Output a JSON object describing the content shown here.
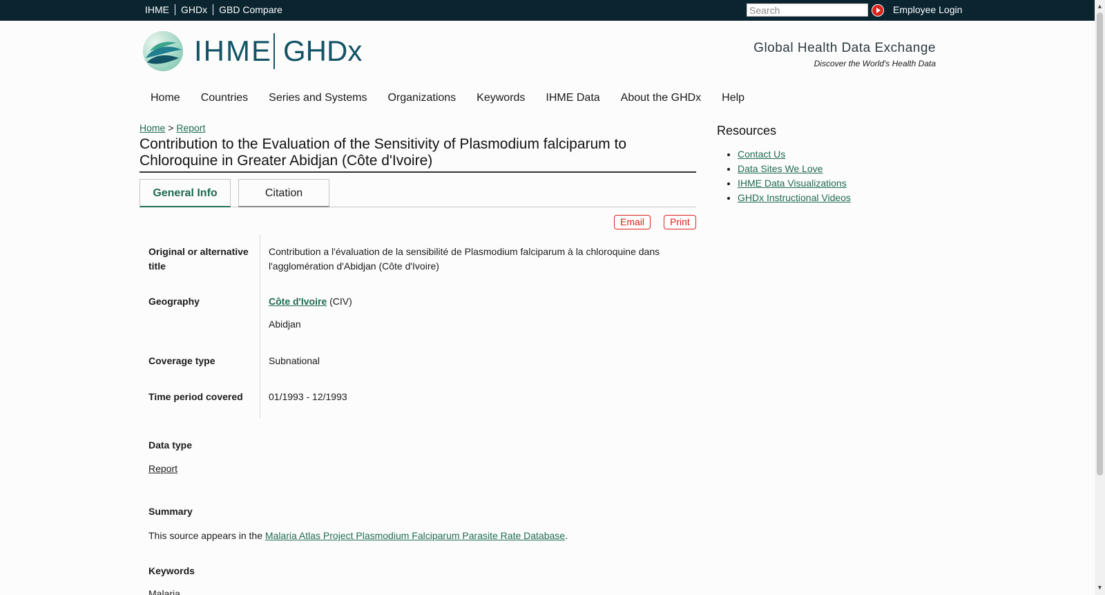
{
  "topbar": {
    "links": [
      "IHME",
      "GHDx",
      "GBD Compare"
    ],
    "search_placeholder": "Search",
    "employee_login": "Employee Login"
  },
  "logo": {
    "ihme": "IHME",
    "ghdx": "GHDx",
    "tagline_title": "Global Health Data Exchange",
    "tagline_sub": "Discover the World's Health Data"
  },
  "nav": [
    "Home",
    "Countries",
    "Series and Systems",
    "Organizations",
    "Keywords",
    "IHME Data",
    "About the GHDx",
    "Help"
  ],
  "breadcrumb": {
    "home": "Home",
    "separator": ">",
    "current": "Report"
  },
  "page_title": "Contribution to the Evaluation of the Sensitivity of Plasmodium falciparum to Chloroquine in Greater Abidjan (Côte d'Ivoire)",
  "tabs": {
    "general": "General Info",
    "citation": "Citation"
  },
  "actions": {
    "email": "Email",
    "print": "Print"
  },
  "fields": {
    "original_title_label": "Original or alternative title",
    "original_title_value": "Contribution a l'évaluation de la sensibilité de Plasmodium falciparum à la chloroquine dans l'agglomération d'Abidjan (Côte d'Ivoire)",
    "geography_label": "Geography",
    "geography_country": "Côte d'Ivoire",
    "geography_code": "(CIV)",
    "geography_city": "Abidjan",
    "coverage_label": "Coverage type",
    "coverage_value": "Subnational",
    "time_label": "Time period covered",
    "time_value": "01/1993 - 12/1993"
  },
  "data_type": {
    "label": "Data type",
    "value": "Report"
  },
  "summary": {
    "label": "Summary",
    "prefix": "This source appears in the",
    "link": "Malaria Atlas Project Plasmodium Falciparum Parasite Rate Database",
    "suffix": "."
  },
  "keywords": {
    "label": "Keywords",
    "first": "Malaria"
  },
  "resources": {
    "title": "Resources",
    "items": [
      "Contact Us",
      "Data Sites We Love",
      "IHME Data Visualizations",
      "GHDx Instructional Videos"
    ]
  },
  "colors": {
    "topbar": "#0a2530",
    "link": "#1d6b52",
    "brand": "#125466",
    "accent_red": "#d8231a"
  },
  "icons": {
    "go": "play-arrow-icon",
    "logo": "ihme-leaf-logo-icon"
  }
}
